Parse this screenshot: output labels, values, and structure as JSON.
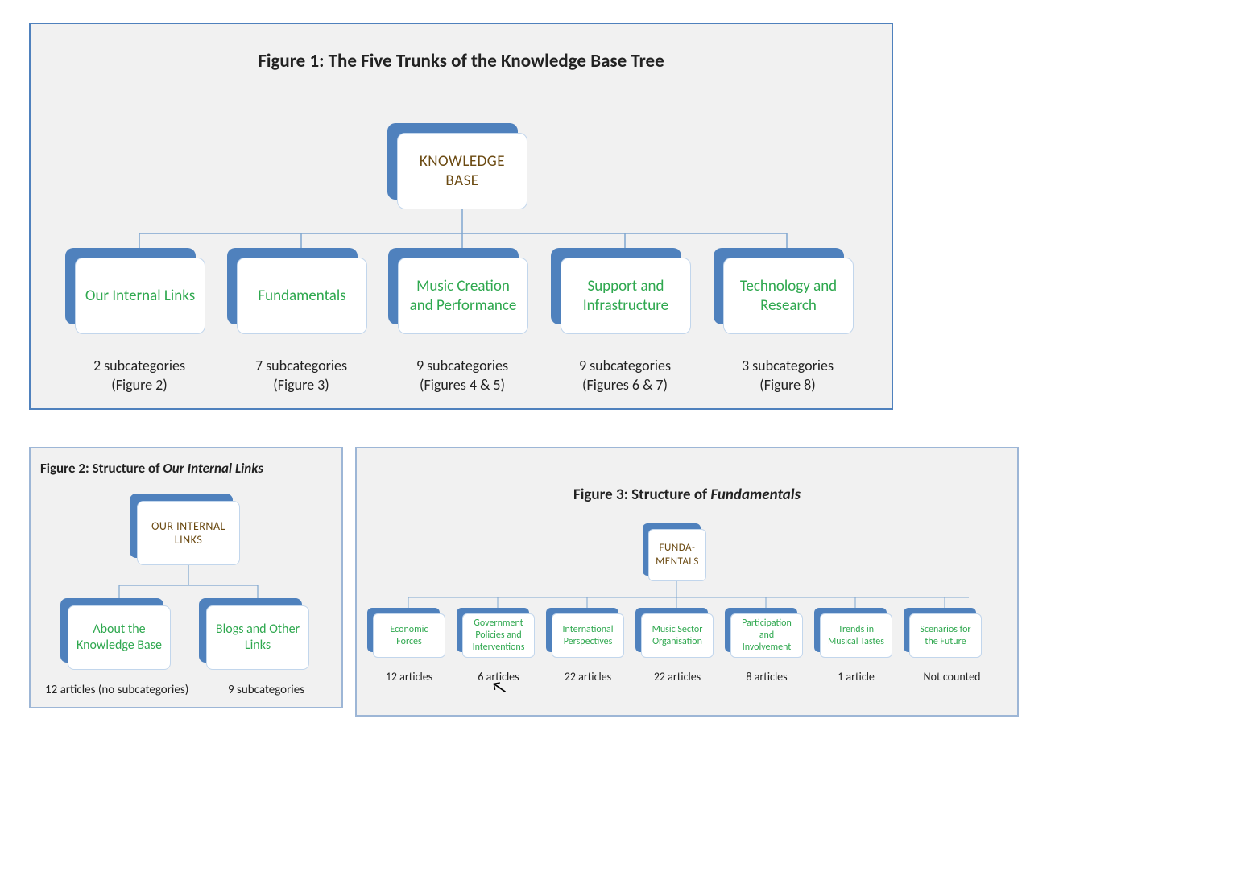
{
  "figure1": {
    "title": "Figure 1: The Five Trunks of the Knowledge Base Tree",
    "root": "KNOWLEDGE BASE",
    "trunks": [
      {
        "label": "Our Internal Links",
        "caption_l1": "2 subcategories",
        "caption_l2": "(Figure 2)"
      },
      {
        "label": "Fundamentals",
        "caption_l1": "7 subcategories",
        "caption_l2": "(Figure 3)"
      },
      {
        "label": "Music Creation and Performance",
        "caption_l1": "9 subcategories",
        "caption_l2": "(Figures 4 & 5)"
      },
      {
        "label": "Support and Infrastructure",
        "caption_l1": "9 subcategories",
        "caption_l2": "(Figures 6 & 7)"
      },
      {
        "label": "Technology and Research",
        "caption_l1": "3 subcategories",
        "caption_l2": "(Figure 8)"
      }
    ]
  },
  "figure2": {
    "title_prefix": "Figure 2: Structure of ",
    "title_italic": "Our Internal Links",
    "root": "OUR INTERNAL LINKS",
    "children": [
      {
        "label": "About the Knowledge Base",
        "caption": "12 articles (no subcategories)"
      },
      {
        "label": "Blogs and Other Links",
        "caption": "9 subcategories"
      }
    ]
  },
  "figure3": {
    "title_prefix": "Figure 3: Structure of ",
    "title_italic": "Fundamentals",
    "root": "FUNDA-\nMENTALS",
    "children": [
      {
        "label": "Economic Forces",
        "caption": "12 articles"
      },
      {
        "label": "Government Policies and Interventions",
        "caption": "6 articles"
      },
      {
        "label": "International Perspectives",
        "caption": "22 articles"
      },
      {
        "label": "Music Sector Organisation",
        "caption": "22 articles"
      },
      {
        "label": "Participation and Involvement",
        "caption": "8 articles"
      },
      {
        "label": "Trends in Musical Tastes",
        "caption": "1 article"
      },
      {
        "label": "Scenarios for the Future",
        "caption": "Not counted"
      }
    ]
  },
  "colors": {
    "panel_border": "#4f81bd",
    "node_shadow": "#4f81bd",
    "trunk_text": "#2fa84f",
    "root_text": "#6b4a12"
  }
}
